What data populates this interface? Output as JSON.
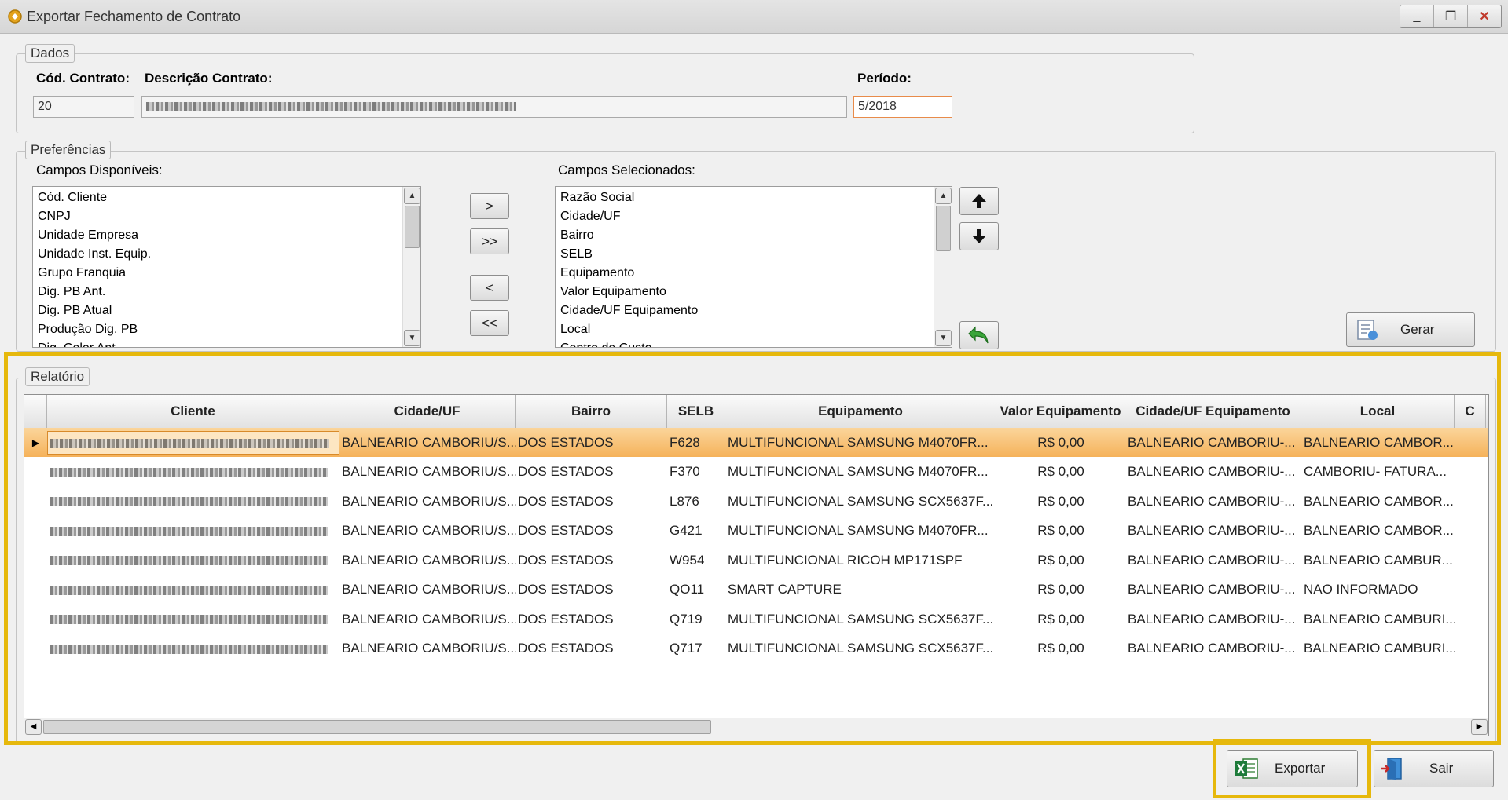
{
  "window": {
    "title": "Exportar Fechamento de Contrato",
    "minimize": "_",
    "maximize": "❐",
    "close": "✕"
  },
  "dados": {
    "legend": "Dados",
    "cod_contrato_label": "Cód. Contrato:",
    "descricao_label": "Descrição Contrato:",
    "periodo_label": "Período:",
    "cod_contrato_value": "20",
    "periodo_value": "5/2018"
  },
  "preferencias": {
    "legend": "Preferências",
    "disponiveis_label": "Campos Disponíveis:",
    "selecionados_label": "Campos Selecionados:",
    "disponiveis": [
      "Cód. Cliente",
      "CNPJ",
      "Unidade Empresa",
      "Unidade Inst. Equip.",
      "Grupo Franquia",
      "Dig. PB Ant.",
      "Dig. PB Atual",
      "Produção Dig. PB",
      "Dig. Color Ant."
    ],
    "selecionados": [
      "Razão Social",
      "Cidade/UF",
      "Bairro",
      "SELB",
      "Equipamento",
      "Valor Equipamento",
      "Cidade/UF Equipamento",
      "Local",
      "Centro de Custo"
    ],
    "btn_add": ">",
    "btn_add_all": ">>",
    "btn_remove": "<",
    "btn_remove_all": "<<",
    "gerar_label": "Gerar"
  },
  "relatorio": {
    "legend": "Relatório",
    "columns": [
      "Cliente",
      "Cidade/UF",
      "Bairro",
      "SELB",
      "Equipamento",
      "Valor Equipamento",
      "Cidade/UF Equipamento",
      "Local",
      "C"
    ],
    "rows": [
      [
        "",
        "BALNEARIO  CAMBORIU/S...",
        "DOS ESTADOS",
        "F628",
        "MULTIFUNCIONAL  SAMSUNG  M4070FR...",
        "R$ 0,00",
        "BALNEARIO  CAMBORIU-...",
        "BALNEARIO  CAMBOR..."
      ],
      [
        "",
        "BALNEARIO  CAMBORIU/S...",
        "DOS ESTADOS",
        "F370",
        "MULTIFUNCIONAL  SAMSUNG  M4070FR...",
        "R$ 0,00",
        "BALNEARIO  CAMBORIU-...",
        "CAMBORIU-  FATURA..."
      ],
      [
        "",
        "BALNEARIO  CAMBORIU/S...",
        "DOS ESTADOS",
        "L876",
        "MULTIFUNCIONAL  SAMSUNG  SCX5637F...",
        "R$ 0,00",
        "BALNEARIO  CAMBORIU-...",
        "BALNEARIO  CAMBOR..."
      ],
      [
        "",
        "BALNEARIO  CAMBORIU/S...",
        "DOS ESTADOS",
        "G421",
        "MULTIFUNCIONAL  SAMSUNG  M4070FR...",
        "R$ 0,00",
        "BALNEARIO  CAMBORIU-...",
        "BALNEARIO  CAMBOR..."
      ],
      [
        "",
        "BALNEARIO  CAMBORIU/S...",
        "DOS ESTADOS",
        "W954",
        "MULTIFUNCIONAL RICOH MP171SPF",
        "R$ 0,00",
        "BALNEARIO  CAMBORIU-...",
        "BALNEARIO  CAMBUR..."
      ],
      [
        "",
        "BALNEARIO  CAMBORIU/S...",
        "DOS ESTADOS",
        "QO11",
        "SMART CAPTURE",
        "R$ 0,00",
        "BALNEARIO  CAMBORIU-...",
        "NAO INFORMADO"
      ],
      [
        "",
        "BALNEARIO  CAMBORIU/S...",
        "DOS ESTADOS",
        "Q719",
        "MULTIFUNCIONAL  SAMSUNG  SCX5637F...",
        "R$ 0,00",
        "BALNEARIO  CAMBORIU-...",
        "BALNEARIO  CAMBURI..."
      ],
      [
        "",
        "BALNEARIO  CAMBORIU/S...",
        "DOS ESTADOS",
        "Q717",
        "MULTIFUNCIONAL  SAMSUNG  SCX5637F...",
        "R$ 0,00",
        "BALNEARIO  CAMBORIU-...",
        "BALNEARIO  CAMBURI..."
      ]
    ]
  },
  "footer": {
    "exportar_label": "Exportar",
    "sair_label": "Sair"
  },
  "colors": {
    "highlight": "#e6b80c",
    "selected_row": "#f5b25a",
    "active_input_border": "#e88b4a"
  }
}
